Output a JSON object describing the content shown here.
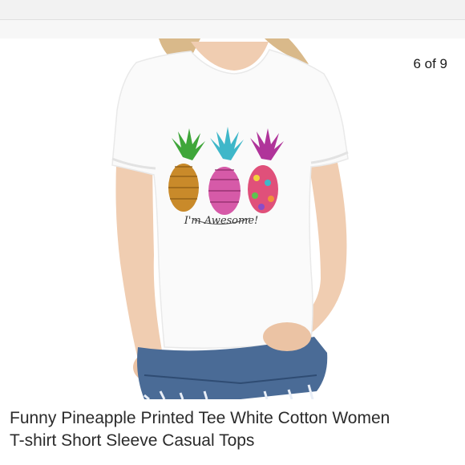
{
  "gallery": {
    "counter": "6 of 9",
    "image_alt": "Woman wearing white t-shirt with three colorful pineapples and the text I'm Awesome!",
    "print_text": "I'm Awesome!"
  },
  "product": {
    "title_line1": "Funny Pineapple Printed Tee White Cotton Women",
    "title_line2": "T-shirt Short Sleeve Casual Tops"
  },
  "colors": {
    "pineapple_1_body": "#c98a2a",
    "pineapple_2_body": "#d65aa8",
    "pineapple_3_body": "#e0507a",
    "leaves_1": "#3fa63a",
    "leaves_2": "#3fb7c9",
    "leaves_3": "#b0349a"
  }
}
